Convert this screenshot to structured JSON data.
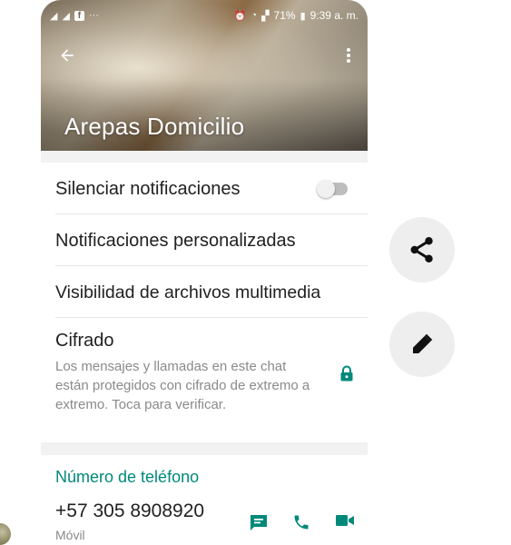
{
  "status_bar": {
    "left_icons": [
      "signal-icon",
      "signal-icon",
      "facebook-icon",
      "more-dots-icon"
    ],
    "battery": "71%",
    "time": "9:39 a. m."
  },
  "header": {
    "title": "Arepas Domicilio",
    "back_icon": "arrow-left-icon",
    "menu_icon": "more-vertical-icon"
  },
  "settings": {
    "mute_label": "Silenciar notificaciones",
    "mute_enabled": false,
    "custom_notifications_label": "Notificaciones personalizadas",
    "media_visibility_label": "Visibilidad de archivos multimedia",
    "encryption_label": "Cifrado",
    "encryption_description": "Los mensajes y llamadas en este chat están protegidos con cifrado de extremo a extremo. Toca para verificar."
  },
  "phone_section": {
    "title": "Número de teléfono",
    "number": "+57 305 8908920",
    "type": "Móvil"
  },
  "side_actions": {
    "share_icon": "share-icon",
    "edit_icon": "pencil-icon"
  },
  "colors": {
    "accent": "#00897b",
    "lock": "#00897b"
  }
}
